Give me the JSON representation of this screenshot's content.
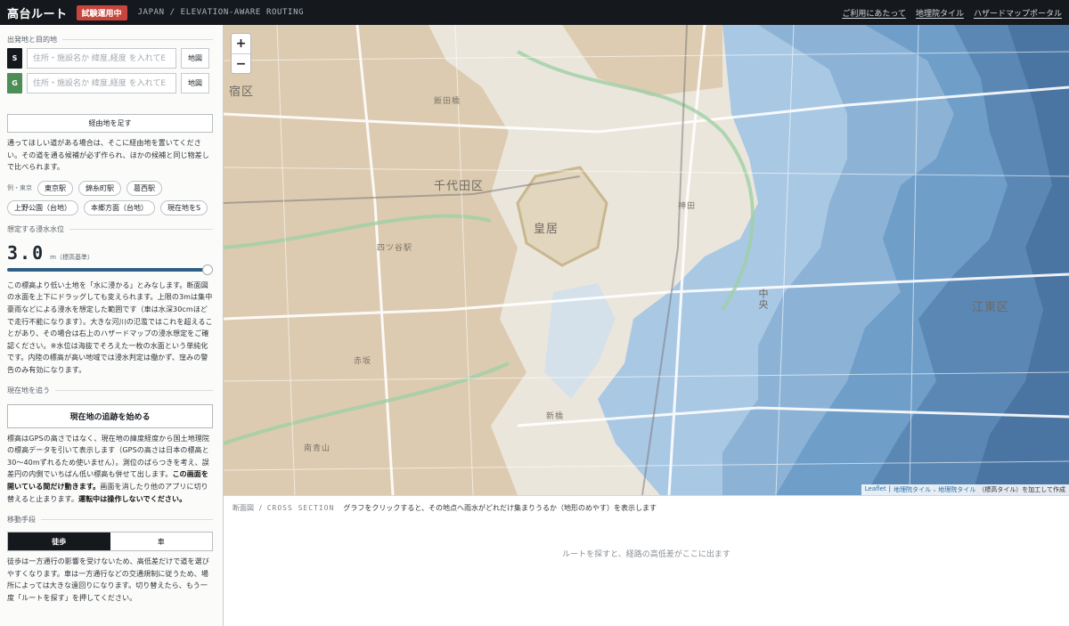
{
  "header": {
    "title": "高台ルート",
    "badge": "試験運用中",
    "subtitle": "JAPAN / ELEVATION-AWARE ROUTING",
    "links": [
      "ご利用にあたって",
      "地理院タイル",
      "ハザードマップポータル"
    ]
  },
  "sidebar": {
    "route": {
      "section_label": "出発地と目的地",
      "start": {
        "mark": "S",
        "placeholder": "住所・施設名か 緯度,経度 を入れてE",
        "map_button": "地図"
      },
      "goal": {
        "mark": "G",
        "placeholder": "住所・施設名か 緯度,経度 を入れてE",
        "map_button": "地図"
      },
      "waypoint_button": "経由地を足す",
      "waypoint_desc": "通ってほしい道がある場合は、そこに経由地を置いてください。その道を通る候補が必ず作られ、ほかの候補と同じ物差しで比べられます。",
      "examples_label": "例・東京",
      "examples": [
        "東京駅",
        "錦糸町駅",
        "葛西駅",
        "上野公園（台地）",
        "本郷方面（台地）",
        "現在地をS"
      ]
    },
    "water": {
      "section_label": "想定する浸水水位",
      "value": "3.0",
      "unit": "m（標高基準）",
      "level_fraction": 1.0,
      "desc": "この標高より低い土地を「水に浸かる」とみなします。断面図の水面を上下にドラッグしても変えられます。上限の3mは集中豪雨などによる浸水を想定した範囲です（車は水深30cmほどで走行不能になります）。大きな河川の氾濫ではこれを超えることがあり、その場合は右上のハザードマップの浸水想定をご確認ください。※水位は海抜でそろえた一枚の水面という単純化です。内陸の標高が高い地域では浸水判定は働かず、窪みの警告のみ有効になります。"
    },
    "tracking": {
      "section_label": "現在地を追う",
      "button": "現在地の追跡を始める",
      "desc_before": "標高はGPSの高さではなく、現在地の緯度経度から国土地理院の標高データを引いて表示します（GPSの高さは日本の標高と30〜40mずれるため使いません）。測位のばらつきを考え、誤差円の内側でいちばん低い標高も併せて出します。",
      "desc_strong1": "この画面を開いている間だけ動きます。",
      "desc_mid": "画面を消したり他のアプリに切り替えると止まります。",
      "desc_strong2": "運転中は操作しないでください。"
    },
    "mode": {
      "section_label": "移動手段",
      "options": [
        "徒歩",
        "車"
      ],
      "selected": "徒歩",
      "desc": "徒歩は一方通行の影響を受けないため、高低差だけで道を選びやすくなります。車は一方通行などの交通規制に従うため、場所によっては大きな遠回りになります。切り替えたら、もう一度「ルートを探す」を押してください。"
    }
  },
  "map": {
    "zoom_in": "+",
    "zoom_out": "−",
    "labels": {
      "chiyoda": "千代田区",
      "shinjuku": "宿区",
      "kokyo": "皇居",
      "chuo": "中央",
      "koto": "江東区",
      "yotsuya": "四ツ谷駅",
      "akasaka": "赤坂",
      "minami_aoyama": "南青山",
      "shinbashi": "新橋",
      "kanda": "神田",
      "iidabashi": "飯田橋"
    },
    "attribution": {
      "leaflet": "Leaflet",
      "sep": "|",
      "tile1": "地理院タイル",
      "comma": ",",
      "tile2": "地理院タイル",
      "suffix": "（標高タイル）を加工して作成"
    }
  },
  "cross_section": {
    "label": "断面図",
    "label_en": "CROSS SECTION",
    "hint": "グラフをクリックすると、その地点へ雨水がどれだけ集まりうるか（地形のめやす）を表示します",
    "empty": "ルートを探すと、経路の高低差がここに出ます"
  },
  "colors": {
    "header_bg": "#15191e",
    "badge": "#c8453c",
    "goal_mark": "#4c8e55",
    "slider": "#2f5f86",
    "water_light": "#a9c8e4",
    "water_mid": "#6f9ec9",
    "water_deep": "#4a75a3"
  }
}
